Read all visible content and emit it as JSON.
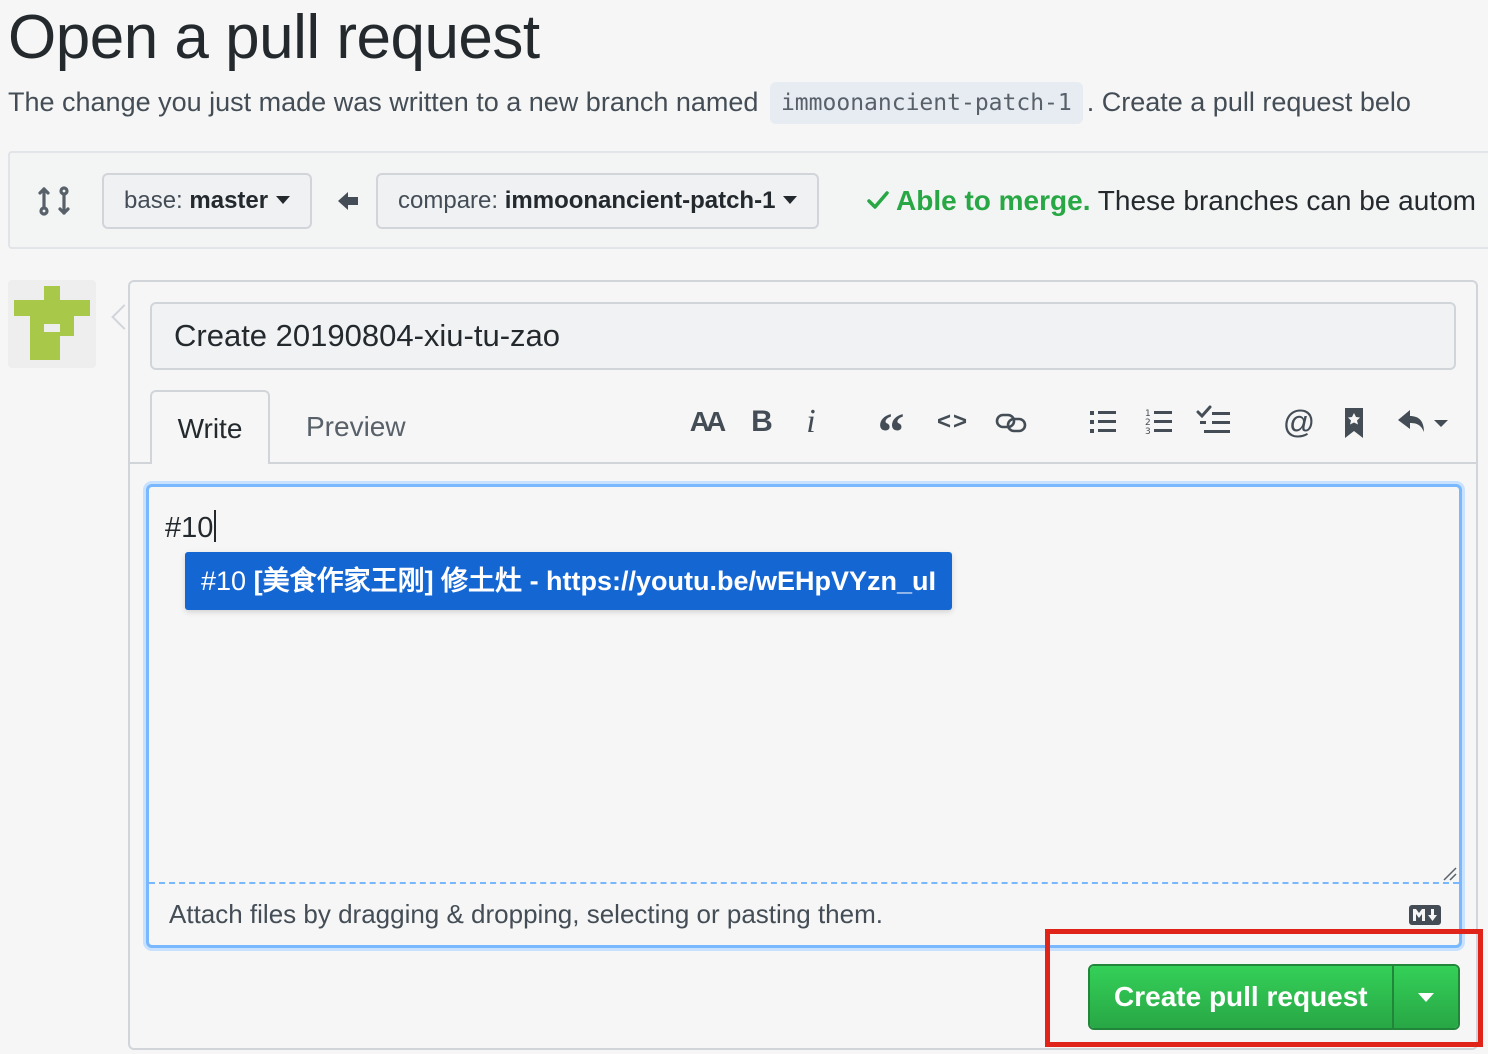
{
  "header": {
    "title": "Open a pull request",
    "subtitle_before": "The change you just made was written to a new branch named",
    "branch_name": "immoonancient-patch-1",
    "subtitle_after": ". Create a pull request belo"
  },
  "compare_bar": {
    "base_label": "base:",
    "base_value": "master",
    "compare_label": "compare:",
    "compare_value": "immoonancient-patch-1",
    "merge_ok": "Able to merge.",
    "merge_rest": "These branches can be autom"
  },
  "form": {
    "title_value": "Create 20190804-xiu-tu-zao",
    "tabs": [
      {
        "label": "Write",
        "active": true
      },
      {
        "label": "Preview",
        "active": false
      }
    ],
    "toolbar": [
      {
        "icon": "text-size-icon",
        "glyph": "AA"
      },
      {
        "icon": "bold-icon",
        "glyph": "B"
      },
      {
        "icon": "italic-icon",
        "glyph": "i"
      },
      {
        "icon": "quote-icon",
        "glyph": "“"
      },
      {
        "icon": "code-icon",
        "glyph": "<>"
      },
      {
        "icon": "link-icon"
      },
      {
        "icon": "unordered-list-icon"
      },
      {
        "icon": "ordered-list-icon"
      },
      {
        "icon": "task-list-icon"
      },
      {
        "icon": "mention-icon",
        "glyph": "@"
      },
      {
        "icon": "saved-reply-icon"
      },
      {
        "icon": "reply-dropdown-icon"
      }
    ],
    "body_text": "#10",
    "suggestion": {
      "number": "#10",
      "text": "[美食作家王刚] 修土灶 - https://youtu.be/wEHpVYzn_uI"
    },
    "attach_hint": "Attach files by dragging & dropping, selecting or pasting them.",
    "submit_label": "Create pull request"
  },
  "colors": {
    "green": "#28a745",
    "blue_suggestion": "#1466d3",
    "highlight_red": "#e0241a"
  }
}
